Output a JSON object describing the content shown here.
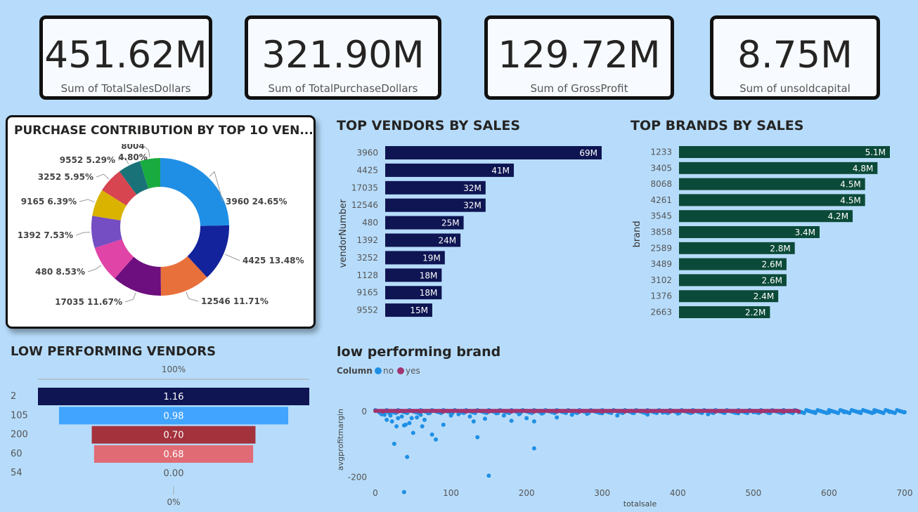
{
  "kpis": [
    {
      "value": "451.62M",
      "label": "Sum of TotalSalesDollars"
    },
    {
      "value": "321.90M",
      "label": "Sum of TotalPurchaseDollars"
    },
    {
      "value": "129.72M",
      "label": "Sum of GrossProfit"
    },
    {
      "value": "8.75M",
      "label": "Sum of unsoldcapital"
    }
  ],
  "colors": {
    "page_bg": "#b7dcfb",
    "vendor_bars": "#0e1552",
    "brand_bars": "#0b4a38",
    "scatter_no": "#1f8fe5",
    "scatter_yes": "#a1346f"
  },
  "chart_data": [
    {
      "type": "pie",
      "title": "PURCHASE CONTRIBUTION BY TOP 1O VEN...",
      "donut": true,
      "slices": [
        {
          "label": "3960",
          "value": 24.65,
          "text": "3960 24.65%",
          "color": "#1f8fe5"
        },
        {
          "label": "4425",
          "value": 13.48,
          "text": "4425 13.48%",
          "color": "#13239b"
        },
        {
          "label": "12546",
          "value": 11.71,
          "text": "12546 11.71%",
          "color": "#e8703a"
        },
        {
          "label": "17035",
          "value": 11.67,
          "text": "17035 11.67%",
          "color": "#6d0f7e"
        },
        {
          "label": "480",
          "value": 8.53,
          "text": "480 8.53%",
          "color": "#e044a7"
        },
        {
          "label": "1392",
          "value": 7.53,
          "text": "1392 7.53%",
          "color": "#744ec2"
        },
        {
          "label": "9165",
          "value": 6.39,
          "text": "9165 6.39%",
          "color": "#d9b300"
        },
        {
          "label": "3252",
          "value": 5.95,
          "text": "3252 5.95%",
          "color": "#d64550"
        },
        {
          "label": "9552",
          "value": 5.29,
          "text": "9552 5.29%",
          "color": "#197278"
        },
        {
          "label": "8004",
          "value": 4.8,
          "text": "8004 4.80%",
          "color": "#1aab40"
        }
      ]
    },
    {
      "type": "bar",
      "orientation": "horizontal",
      "title": "TOP VENDORS BY SALES",
      "ylabel": "vendorNumber",
      "categories": [
        "3960",
        "4425",
        "17035",
        "12546",
        "480",
        "1392",
        "3252",
        "1128",
        "9165",
        "9552"
      ],
      "values": [
        69,
        41,
        32,
        32,
        25,
        24,
        19,
        18,
        18,
        15
      ],
      "data_labels": [
        "69M",
        "41M",
        "32M",
        "32M",
        "25M",
        "24M",
        "19M",
        "18M",
        "18M",
        "15M"
      ],
      "xlim": [
        0,
        69
      ]
    },
    {
      "type": "bar",
      "orientation": "horizontal",
      "title": "TOP BRANDS BY SALES",
      "ylabel": "brand",
      "categories": [
        "1233",
        "3405",
        "8068",
        "4261",
        "3545",
        "3858",
        "2589",
        "3489",
        "3102",
        "1376",
        "2663"
      ],
      "values": [
        5.1,
        4.8,
        4.5,
        4.5,
        4.2,
        3.4,
        2.8,
        2.6,
        2.6,
        2.4,
        2.2
      ],
      "data_labels": [
        "5.1M",
        "4.8M",
        "4.5M",
        "4.5M",
        "4.2M",
        "3.4M",
        "2.8M",
        "2.6M",
        "2.6M",
        "2.4M",
        "2.2M"
      ],
      "xlim": [
        0,
        5.1
      ]
    },
    {
      "type": "bar",
      "subtype": "funnel",
      "title": "LOW PERFORMING VENDORS",
      "top_label": "100%",
      "bottom_label": "0%",
      "categories": [
        "2",
        "105",
        "200",
        "60",
        "54"
      ],
      "values": [
        1.16,
        0.98,
        0.7,
        0.68,
        0.0
      ],
      "data_labels": [
        "1.16",
        "0.98",
        "0.70",
        "0.68",
        "0.00"
      ],
      "colors": [
        "#0e1552",
        "#41a4ff",
        "#a3323c",
        "#e06b74",
        "#e06b74"
      ]
    },
    {
      "type": "scatter",
      "title": "low performing brand",
      "legend_title": "Column",
      "legend_position": "top-left",
      "xlabel": "totalsale",
      "ylabel": "avgprofitmargin",
      "xlim": [
        0,
        700
      ],
      "ylim": [
        -250,
        20
      ],
      "x_ticks": [
        0,
        100,
        200,
        300,
        400,
        500,
        600,
        700
      ],
      "y_ticks": [
        0,
        -200
      ],
      "series": [
        {
          "name": "no",
          "color": "#1f8fe5",
          "points": [
            [
              5,
              -2
            ],
            [
              8,
              -8
            ],
            [
              12,
              -10
            ],
            [
              15,
              -25
            ],
            [
              18,
              -4
            ],
            [
              20,
              -12
            ],
            [
              22,
              -30
            ],
            [
              25,
              -98
            ],
            [
              28,
              -45
            ],
            [
              30,
              -20
            ],
            [
              35,
              -15
            ],
            [
              38,
              -42
            ],
            [
              40,
              -40
            ],
            [
              42,
              -138
            ],
            [
              45,
              -35
            ],
            [
              48,
              -20
            ],
            [
              50,
              -65
            ],
            [
              55,
              -18
            ],
            [
              60,
              -10
            ],
            [
              62,
              -45
            ],
            [
              65,
              -25
            ],
            [
              70,
              -5
            ],
            [
              75,
              -70
            ],
            [
              80,
              -85
            ],
            [
              90,
              -40
            ],
            [
              100,
              -12
            ],
            [
              110,
              -8
            ],
            [
              125,
              -15
            ],
            [
              130,
              -30
            ],
            [
              135,
              -78
            ],
            [
              145,
              -22
            ],
            [
              150,
              -195
            ],
            [
              160,
              -5
            ],
            [
              170,
              -12
            ],
            [
              180,
              -28
            ],
            [
              190,
              -8
            ],
            [
              200,
              -20
            ],
            [
              210,
              -112
            ],
            [
              220,
              -6
            ],
            [
              240,
              -18
            ],
            [
              260,
              -10
            ],
            [
              280,
              -7
            ],
            [
              300,
              -5
            ],
            [
              320,
              -12
            ],
            [
              340,
              -4
            ],
            [
              360,
              -9
            ],
            [
              380,
              -3
            ],
            [
              400,
              -6
            ],
            [
              420,
              -2
            ],
            [
              440,
              -8
            ],
            [
              460,
              -3
            ],
            [
              480,
              -5
            ],
            [
              500,
              -2
            ],
            [
              520,
              -4
            ],
            [
              540,
              -3
            ],
            [
              560,
              -2
            ],
            [
              580,
              -1
            ],
            [
              600,
              -3
            ],
            [
              620,
              -2
            ],
            [
              640,
              -1
            ],
            [
              660,
              -2
            ],
            [
              680,
              -1
            ],
            [
              700,
              -2
            ],
            [
              38,
              -245
            ],
            [
              210,
              -30
            ]
          ]
        },
        {
          "name": "yes",
          "color": "#a1346f",
          "points": [
            [
              10,
              0
            ],
            [
              30,
              0
            ],
            [
              60,
              0
            ],
            [
              90,
              0
            ],
            [
              120,
              0
            ],
            [
              150,
              0
            ],
            [
              180,
              0
            ],
            [
              210,
              0
            ],
            [
              240,
              0
            ],
            [
              270,
              0
            ],
            [
              300,
              0
            ],
            [
              330,
              0
            ],
            [
              360,
              0
            ],
            [
              390,
              0
            ],
            [
              420,
              0
            ],
            [
              450,
              0
            ],
            [
              480,
              0
            ],
            [
              510,
              0
            ],
            [
              540,
              0
            ],
            [
              560,
              0
            ]
          ]
        }
      ]
    }
  ]
}
